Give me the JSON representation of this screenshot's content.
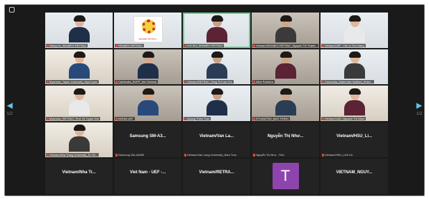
{
  "window": {
    "prev_page": "1/2",
    "next_page": "1/2"
  },
  "tiles": [
    {
      "kind": "video",
      "caption": "Giang Vu_SEAMEO RETRAC"
    },
    {
      "kind": "logo",
      "logo_text": "SEAMEO RETRAC",
      "caption": "SEAMEO RETRAC"
    },
    {
      "kind": "video",
      "caption": "Linh Bui_SEAMEO RETRAC"
    },
    {
      "kind": "video",
      "caption": "Vietnam/SEAMEO RETRAC_Nguyen Thi Thanh..."
    },
    {
      "kind": "video",
      "caption": "Vietnam/UEF - Ha Le Thu Hang"
    },
    {
      "kind": "video",
      "caption": "Myanmar_Taylor University_Mya Kyaw"
    },
    {
      "kind": "video",
      "caption": "Cambodia_RUPP_Kim Veasna"
    },
    {
      "kind": "video",
      "caption": "Vietnam/RETRAC_Tang Thi Lan Chi"
    },
    {
      "kind": "video",
      "caption": "Alice Pandora"
    },
    {
      "kind": "video",
      "caption": "Cambodia_Mahendra Institute_Khiev..."
    },
    {
      "kind": "video",
      "caption": "Myanmar_RETRAC_Prof. Dr. Kyaw Sint"
    },
    {
      "kind": "video",
      "caption": "NGHIA UEF"
    },
    {
      "kind": "video",
      "caption": "Quang Thinh Tran"
    },
    {
      "kind": "video",
      "caption": "ETHAN/TBD_BAO TRINH"
    },
    {
      "kind": "video",
      "caption": "Vietnam/UAH_Nguyen Thi Nhan"
    },
    {
      "kind": "video",
      "caption": "Vietnam/Nha Trang University_To Thi..."
    },
    {
      "kind": "blank",
      "name": "Samsung  SM-A3...",
      "caption": "Samsung SM-A336E"
    },
    {
      "kind": "blank",
      "name": "Vietnam/Van La...",
      "caption": "Vietnam/Van Lang University_Nam Tran"
    },
    {
      "kind": "blank",
      "name": "Nguyễn Thị Như...",
      "caption": "Nguyễn Thị Như - TNU"
    },
    {
      "kind": "blank",
      "name": "Vietnam/HSU_Li...",
      "caption": "Vietnam/HSU_Linh Ho"
    },
    {
      "kind": "blank",
      "name": "Vietnam/Nha Tr...",
      "caption": ""
    },
    {
      "kind": "blank",
      "name": "Viet Nam - UEF -...",
      "caption": ""
    },
    {
      "kind": "blank",
      "name": "Vietnam/RETRA...",
      "caption": ""
    },
    {
      "kind": "avatar",
      "letter": "T",
      "caption": ""
    },
    {
      "kind": "blank",
      "name": "VIETNAM_NGUY...",
      "caption": ""
    }
  ]
}
